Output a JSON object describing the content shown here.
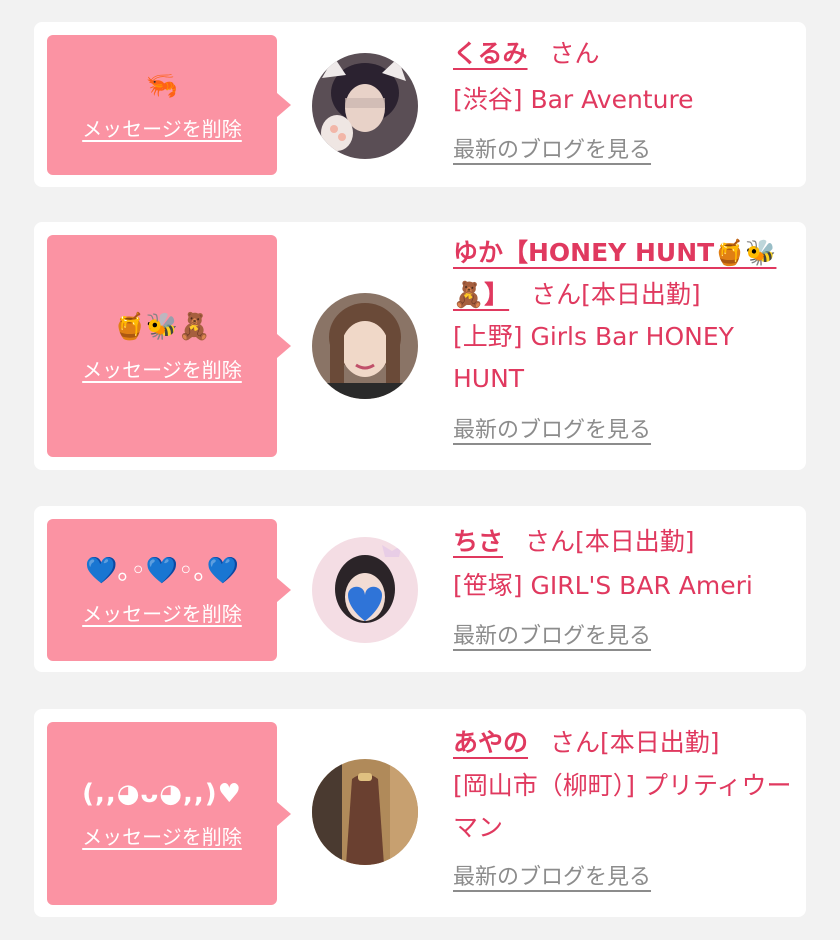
{
  "cards": [
    {
      "message": "🦐",
      "delete_label": "メッセージを削除",
      "name": "くるみ",
      "suffix": "さん",
      "shop": "[渋谷] Bar Aventure",
      "blog_label": "最新のブログを見る"
    },
    {
      "message": "🍯🐝🧸",
      "delete_label": "メッセージを削除",
      "name": "ゆか【HONEY HUNT🍯🐝🧸】",
      "suffix": "さん[本日出勤]",
      "shop": "[上野] Girls Bar HONEY HUNT",
      "blog_label": "最新のブログを見る"
    },
    {
      "message": "💙｡◦💙◦｡💙",
      "delete_label": "メッセージを削除",
      "name": "ちさ",
      "suffix": "さん[本日出勤]",
      "shop": "[笹塚] GIRL'S BAR Ameri",
      "blog_label": "最新のブログを見る"
    },
    {
      "message": "(,,◕ᴗ◕,,)♥",
      "delete_label": "メッセージを削除",
      "name": "あやの",
      "suffix": "さん[本日出勤]",
      "shop": "[岡山市（柳町）] プリティウーマン",
      "blog_label": "最新のブログを見る"
    }
  ],
  "colors": {
    "bubble": "#fb93a3",
    "accent": "#e0395f",
    "link_gray": "#8c8c8c",
    "background": "#f2f2f2"
  }
}
